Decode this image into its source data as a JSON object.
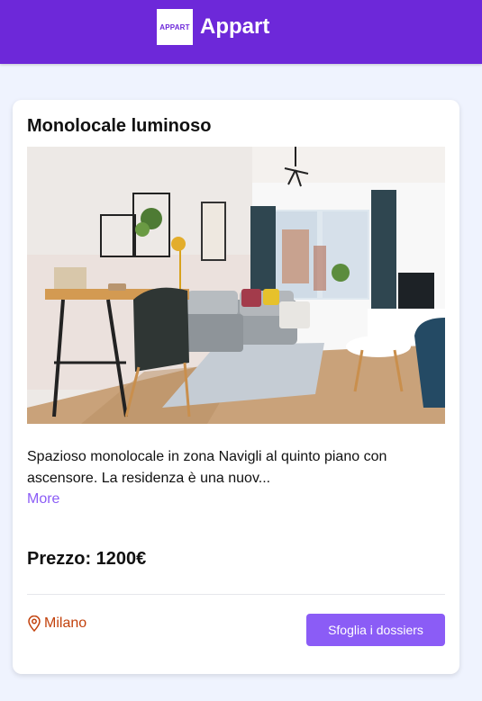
{
  "header": {
    "logo_text": "APPART",
    "brand_name": "Appart",
    "background_color": "#6d28d9"
  },
  "listing": {
    "title": "Monolocale luminoso",
    "image_alt": "Monolocale luminoso",
    "description": "Spazioso monolocale in zona Navigli al quinto piano con ascensore. La residenza è una nuov...",
    "more_label": "More",
    "price": "Prezzo: 1200€",
    "location": "Milano",
    "location_icon": "map-pin-icon",
    "cta_label": "Sfoglia i dossiers",
    "accent_color": "#8b5cf6",
    "location_color": "#c2410c"
  }
}
